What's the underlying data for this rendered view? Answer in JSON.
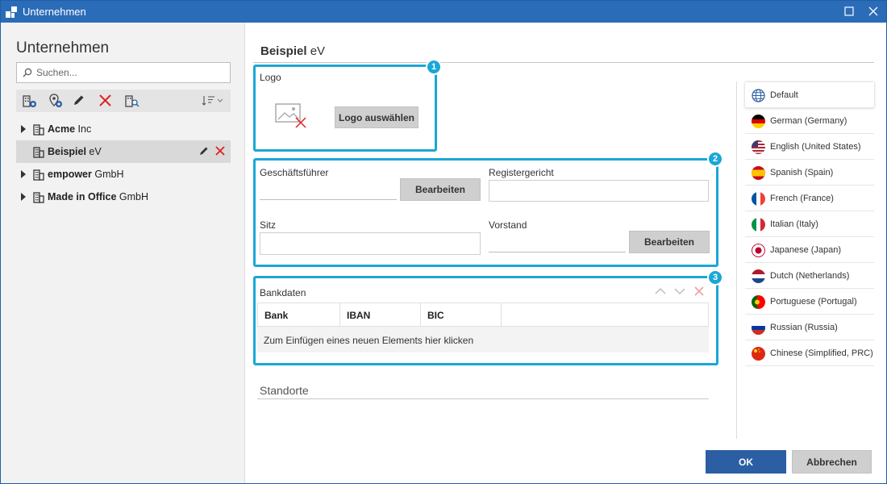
{
  "window": {
    "title": "Unternehmen"
  },
  "left": {
    "title": "Unternehmen",
    "search_placeholder": "Suchen...",
    "toolbar": [
      "add-company-icon",
      "add-location-icon",
      "edit-icon",
      "delete-icon",
      "search-company-icon",
      "sort-icon"
    ],
    "tree": [
      {
        "bold": "Acme",
        "rest": " Inc",
        "expandable": true,
        "selected": false
      },
      {
        "bold": "Beispiel",
        "rest": " eV",
        "expandable": false,
        "selected": true
      },
      {
        "bold": "empower",
        "rest": " GmbH",
        "expandable": true,
        "selected": false
      },
      {
        "bold": "Made in Office",
        "rest": " GmbH",
        "expandable": true,
        "selected": false
      }
    ]
  },
  "main": {
    "title_bold": "Beispiel",
    "title_rest": " eV",
    "logo": {
      "label": "Logo",
      "button": "Logo auswählen"
    },
    "fields": {
      "geschaeftsfuehrer": "Geschäftsführer",
      "registergericht": "Registergericht",
      "sitz": "Sitz",
      "vorstand": "Vorstand",
      "edit_button": "Bearbeiten"
    },
    "bank": {
      "label": "Bankdaten",
      "columns": [
        "Bank",
        "IBAN",
        "BIC"
      ],
      "new_row": "Zum Einfügen eines neuen Elements hier klicken"
    },
    "standorte": "Standorte",
    "callouts": [
      "1",
      "2",
      "3"
    ]
  },
  "languages": [
    {
      "label": "Default",
      "flag": "globe",
      "active": true
    },
    {
      "label": "German (Germany)",
      "flag": "de"
    },
    {
      "label": "English (United States)",
      "flag": "us"
    },
    {
      "label": "Spanish (Spain)",
      "flag": "es"
    },
    {
      "label": "French (France)",
      "flag": "fr"
    },
    {
      "label": "Italian (Italy)",
      "flag": "it"
    },
    {
      "label": "Japanese (Japan)",
      "flag": "jp"
    },
    {
      "label": "Dutch (Netherlands)",
      "flag": "nl"
    },
    {
      "label": "Portuguese (Portugal)",
      "flag": "pt"
    },
    {
      "label": "Russian (Russia)",
      "flag": "ru"
    },
    {
      "label": "Chinese (Simplified, PRC)",
      "flag": "cn"
    }
  ],
  "footer": {
    "ok": "OK",
    "cancel": "Abbrechen"
  },
  "colors": {
    "titlebar": "#2b6cb8",
    "accent": "#1aa7d6",
    "ok": "#2b5ea3",
    "delete": "#e02020"
  }
}
